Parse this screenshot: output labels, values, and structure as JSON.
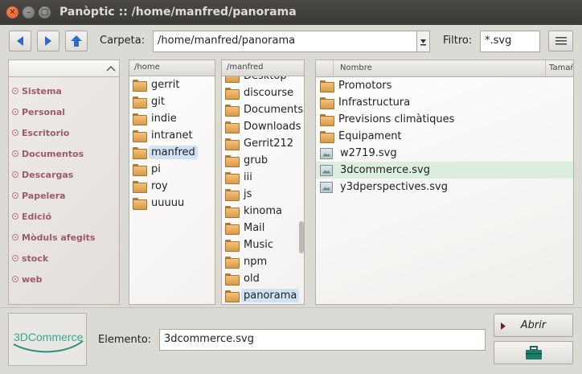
{
  "window": {
    "title": "Panòptic :: /home/manfred/panorama",
    "close_glyph": "✕",
    "minimize_glyph": "–",
    "maximize_glyph": "□"
  },
  "toolbar": {
    "folder_label": "Carpeta:",
    "folder_value": "/home/manfred/panorama",
    "filter_label": "Filtro:",
    "filter_value": "*.svg"
  },
  "places": {
    "items": [
      "Sistema",
      "Personal",
      "Escritorio",
      "Documentos",
      "Descargas",
      "Papelera",
      "Edició",
      "Mòduls afegits",
      "stock",
      "web"
    ]
  },
  "columns": {
    "home": {
      "header": "/home",
      "items": [
        "gerrit",
        "git",
        "indie",
        "intranet",
        "manfred",
        "pi",
        "roy",
        "uuuuu"
      ],
      "selected": "manfred"
    },
    "manfred": {
      "header": "/manfred",
      "items": [
        "Desktop",
        "discourse",
        "Documents",
        "Downloads",
        "Gerrit212",
        "grub",
        "iii",
        "js",
        "kinoma",
        "Mail",
        "Music",
        "npm",
        "old",
        "panorama"
      ],
      "selected": "panorama"
    }
  },
  "files": {
    "header_name": "Nombre",
    "header_size": "Tamañ",
    "folders": [
      "Promotors",
      "Infrastructura",
      "Previsions climàtiques",
      "Equipament"
    ],
    "images": [
      "w2719.svg",
      "3dcommerce.svg",
      "y3dperspectives.svg"
    ],
    "selected": "3dcommerce.svg"
  },
  "bottom": {
    "logo_text": "3DCommerce",
    "element_label": "Elemento:",
    "element_value": "3dcommerce.svg",
    "open_label": "Abrir"
  },
  "colors": {
    "accent": "#2f6bc5",
    "selection": "#cfe1f3",
    "file_selection": "#dcefdc"
  }
}
